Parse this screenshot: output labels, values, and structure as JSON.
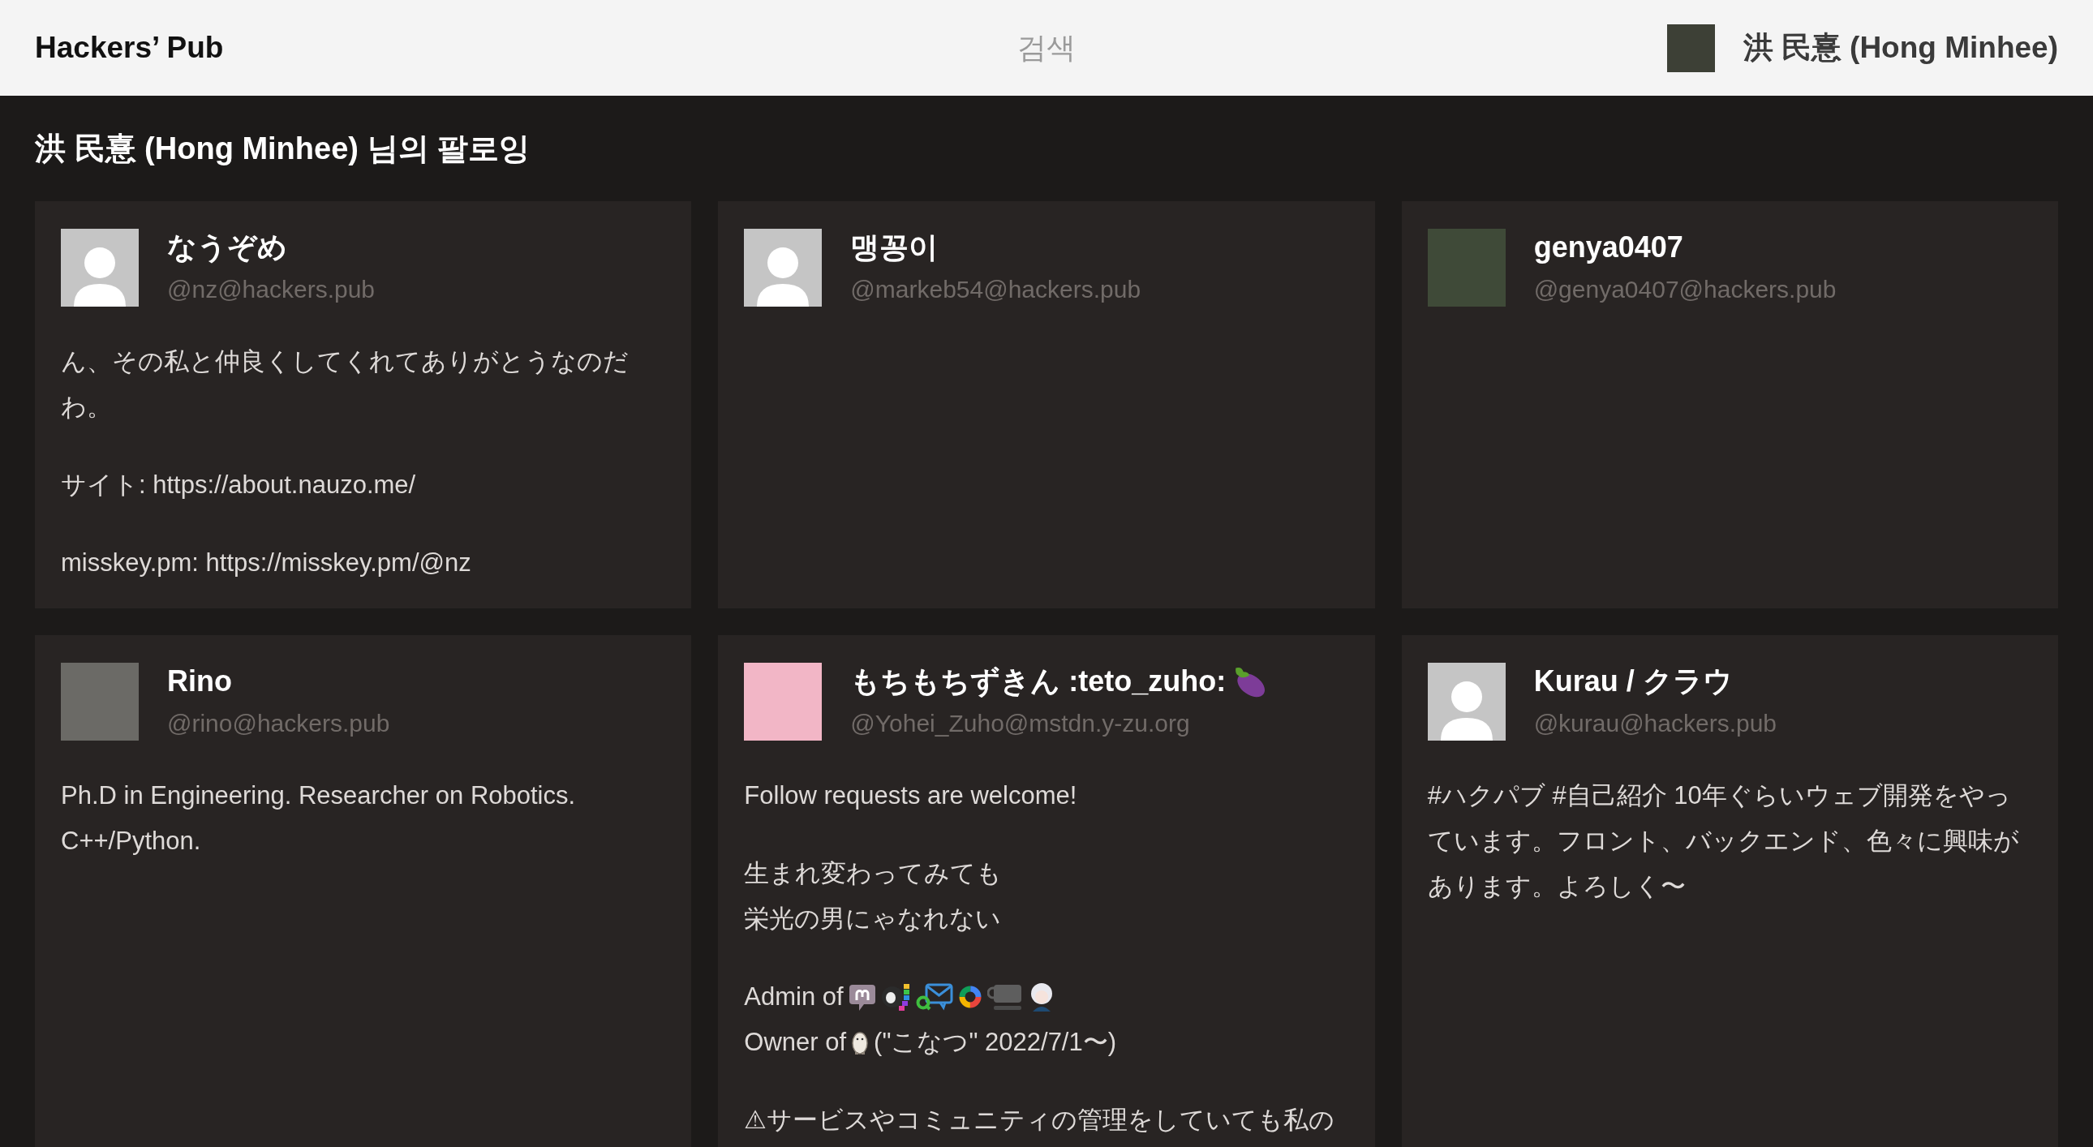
{
  "header": {
    "logo": "Hackers’ Pub",
    "search": {
      "placeholder": "검색"
    },
    "user": {
      "name": "洪 民憙 (Hong Minhee)",
      "avatar": {
        "kind": "photo",
        "color": "#3d4036"
      }
    }
  },
  "page_title": "洪 民憙 (Hong Minhee) 님의 팔로잉",
  "profiles": [
    {
      "name": "なうぞめ",
      "handle": "@nz@hackers.pub",
      "avatar": {
        "kind": "default"
      },
      "bio": [
        {
          "kind": "text",
          "text": "ん、その私と仲良くしてくれてありがとうなのだわ。"
        },
        {
          "kind": "text",
          "text": "サイト: https://about.nauzo.me/"
        },
        {
          "kind": "text",
          "text": "misskey.pm: https://misskey.pm/@nz"
        }
      ]
    },
    {
      "name": "맹꽁이",
      "handle": "@markeb54@hackers.pub",
      "avatar": {
        "kind": "default"
      }
    },
    {
      "name": "genya0407",
      "handle": "@genya0407@hackers.pub",
      "avatar": {
        "kind": "photo",
        "color": "#3f4a38"
      }
    },
    {
      "name": "Rino",
      "handle": "@rino@hackers.pub",
      "avatar": {
        "kind": "photo",
        "color": "#6b6a66"
      },
      "bio": [
        {
          "kind": "text",
          "text": "Ph.D in Engineering. Researcher on Robotics. C++/Python."
        }
      ]
    },
    {
      "name": "もちもちずきん :teto_zuho:",
      "name_icon": true,
      "handle": "@Yohei_Zuho@mstdn.y-zu.org",
      "avatar": {
        "kind": "photo",
        "color": "#f2b6c6"
      },
      "bio": [
        {
          "kind": "text",
          "text": "Follow requests are welcome!"
        },
        {
          "kind": "lines",
          "lines": [
            {
              "kind": "text",
              "text": "生まれ変わってみても"
            },
            {
              "kind": "text",
              "text": "栄光の男にゃなれない"
            }
          ]
        },
        {
          "kind": "lines",
          "lines": [
            {
              "kind": "admin",
              "label": "Admin of"
            },
            {
              "kind": "owner",
              "label": "Owner of",
              "note": "(\"こなつ\" 2022/7/1〜)"
            }
          ]
        },
        {
          "kind": "lines",
          "lines": [
            {
              "kind": "text",
              "text": "⚠サービスやコミュニティの管理をしていても私の"
            }
          ]
        }
      ]
    },
    {
      "name": "Kurau / クラウ",
      "handle": "@kurau@hackers.pub",
      "avatar": {
        "kind": "default"
      },
      "bio": [
        {
          "kind": "text",
          "text": "#ハクパブ #自己紹介 10年ぐらいウェブ開発をやっています。フロント、バックエンド、色々に興味があります。よろしく〜"
        }
      ]
    }
  ]
}
